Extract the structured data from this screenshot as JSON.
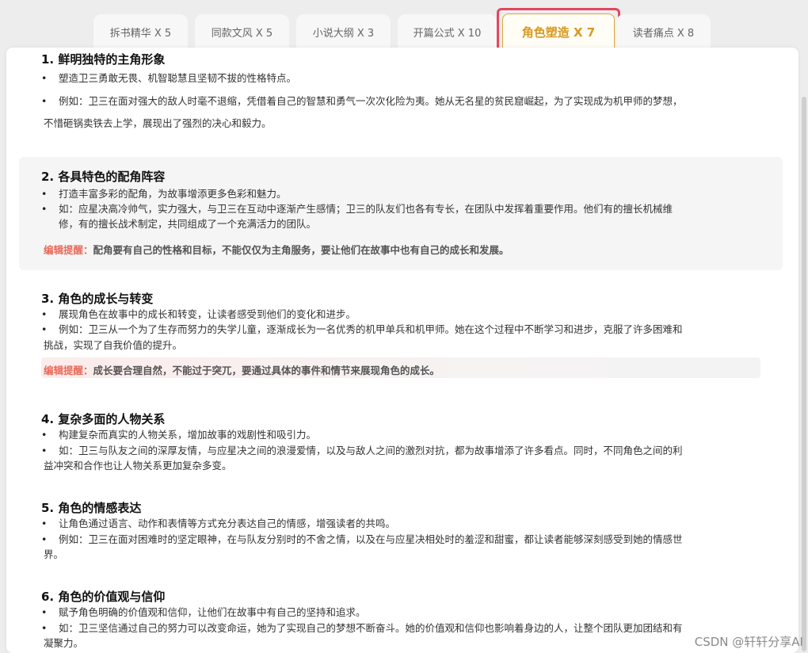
{
  "tabs": [
    {
      "label": "拆书精华 X 5"
    },
    {
      "label": "同款文风 X 5"
    },
    {
      "label": "小说大纲 X 3"
    },
    {
      "label": "开篇公式 X 10"
    },
    {
      "label": "角色塑造 X 7"
    },
    {
      "label": "读者痛点 X 8"
    }
  ],
  "sections": [
    {
      "title": "1. 鲜明独特的主角形象",
      "bullet1": "塑造卫三勇敢无畏、机智聪慧且坚韧不拔的性格特点。",
      "bullet2": "例如：卫三在面对强大的敌人时毫不退缩，凭借着自己的智慧和勇气一次次化险为夷。她从无名星的贫民窟崛起，为了实现成为机甲师的梦想，",
      "bullet2_cont": "不惜砸锅卖铁去上学，展现出了强烈的决心和毅力。"
    },
    {
      "title": "2. 各具特色的配角阵容",
      "bullet1": "打造丰富多彩的配角，为故事增添更多色彩和魅力。",
      "bullet2": "如：应星决高冷帅气，实力强大，与卫三在互动中逐渐产生感情；卫三的队友们也各有专长，在团队中发挥着重要作用。他们有的擅长机械维",
      "bullet2_cont": "修，有的擅长战术制定，共同组成了一个充满活力的团队。",
      "note_label": "编辑提醒：",
      "note_text": "配角要有自己的性格和目标，不能仅仅为主角服务，要让他们在故事中也有自己的成长和发展。"
    },
    {
      "title": "3. 角色的成长与转变",
      "bullet1": "展现角色在故事中的成长和转变，让读者感受到他们的变化和进步。",
      "bullet2": "例如：卫三从一个为了生存而努力的失学儿童，逐渐成长为一名优秀的机甲单兵和机甲师。她在这个过程中不断学习和进步，克服了许多困难和",
      "bullet2_cont": "挑战，实现了自我价值的提升。",
      "note_label": "编辑提醒：",
      "note_text": "成长要合理自然，不能过于突兀，要通过具体的事件和情节来展现角色的成长。"
    },
    {
      "title": "4. 复杂多面的人物关系",
      "bullet1": "构建复杂而真实的人物关系，增加故事的戏剧性和吸引力。",
      "bullet2": "如：卫三与队友之间的深厚友情，与应星决之间的浪漫爱情，以及与敌人之间的激烈对抗，都为故事增添了许多看点。同时，不同角色之间的利",
      "bullet2_cont": "益冲突和合作也让人物关系更加复杂多变。"
    },
    {
      "title": "5. 角色的情感表达",
      "bullet1": "让角色通过语言、动作和表情等方式充分表达自己的情感，增强读者的共鸣。",
      "bullet2": "例如：卫三在面对困难时的坚定眼神，在与队友分别时的不舍之情，以及在与应星决相处时的羞涩和甜蜜，都让读者能够深刻感受到她的情感世",
      "bullet2_cont": "界。"
    },
    {
      "title": "6. 角色的价值观与信仰",
      "bullet1": "赋予角色明确的价值观和信仰，让他们在故事中有自己的坚持和追求。",
      "bullet2": "如：卫三坚信通过自己的努力可以改变命运，她为了实现自己的梦想不断奋斗。她的价值观和信仰也影响着身边的人，让整个团队更加团结和有",
      "bullet2_cont": "凝聚力。"
    }
  ],
  "watermark": "CSDN @轩轩分享AI"
}
